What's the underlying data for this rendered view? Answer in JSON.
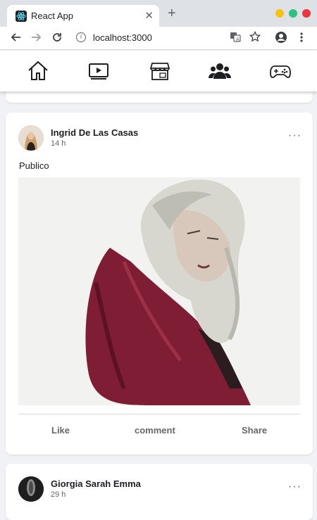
{
  "browser": {
    "tab_title": "React App",
    "tab_close": "✕",
    "new_tab": "+",
    "url": "localhost:3000",
    "colors": {
      "tabbar": "#dee1e6",
      "yellow": "#f5c211",
      "green": "#2ec27e",
      "red": "#ed333b"
    }
  },
  "nav": {
    "items": [
      {
        "name": "home-icon",
        "active": false
      },
      {
        "name": "watch-video-icon",
        "active": false
      },
      {
        "name": "marketplace-store-icon",
        "active": false
      },
      {
        "name": "groups-people-icon",
        "active": true
      },
      {
        "name": "gaming-controller-icon",
        "active": false
      }
    ]
  },
  "posts": [
    {
      "author": "Ingrid De Las Casas",
      "time": "14 h",
      "more": "···",
      "text": "Publico",
      "actions": {
        "like": "Like",
        "comment": "comment",
        "share": "Share"
      }
    },
    {
      "author": "Giorgia Sarah Emma",
      "time": "29 h",
      "more": "···"
    }
  ]
}
